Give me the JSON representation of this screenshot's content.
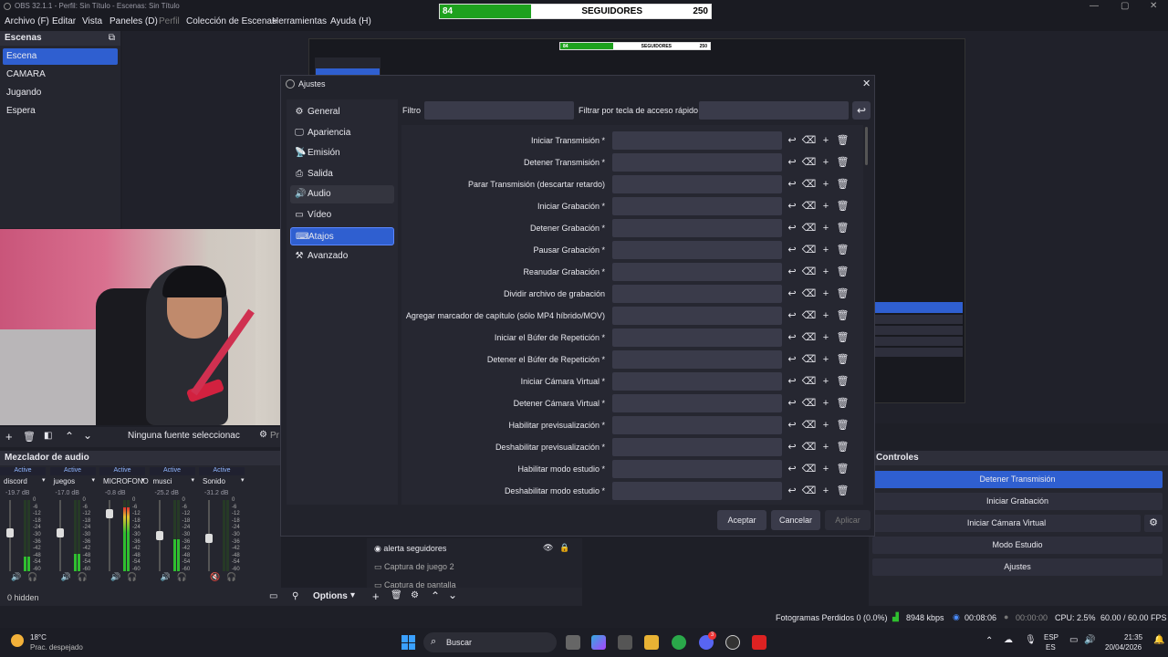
{
  "window": {
    "title": "OBS 32.1.1 - Perfil: Sin Título - Escenas: Sin Título"
  },
  "menu": [
    "Archivo (F)",
    "Editar",
    "Vista",
    "Paneles (D)",
    "Perfil",
    "Colección de Escenas",
    "Herramientas",
    "Ayuda (H)"
  ],
  "followers": {
    "current": "84",
    "label": "SEGUIDORES",
    "goal": "250",
    "progress": 0.336
  },
  "scenes": {
    "title": "Escenas",
    "items": [
      "Escena",
      "CAMARA",
      "Jugando",
      "Espera"
    ],
    "selected": 0
  },
  "sources_toolbar": {
    "no_source": "Ninguna fuente seleccionac",
    "props": "Pr"
  },
  "mixer": {
    "title": "Mezclador de audio",
    "channels": [
      {
        "name": "discord",
        "state": "Active",
        "db": "-19.7 dB",
        "level": 0.2,
        "fader": 0.55
      },
      {
        "name": "juegos",
        "state": "Active",
        "db": "-17.0 dB",
        "level": 0.25,
        "fader": 0.55
      },
      {
        "name": "MICROFONO",
        "state": "Active",
        "db": "-0.8 dB",
        "level": 0.9,
        "fader": 0.85
      },
      {
        "name": "musci",
        "state": "Active",
        "db": "-25.2 dB",
        "level": 0.45,
        "fader": 0.5
      },
      {
        "name": "Sonido",
        "state": "Active",
        "db": "-31.2 dB",
        "level": 0.0,
        "fader": 0.45
      }
    ],
    "scale": [
      "0",
      "-6",
      "-12",
      "-18",
      "-24",
      "-30",
      "-36",
      "-42",
      "-48",
      "-54",
      "-60"
    ],
    "hidden": "0 hidden",
    "options": "Options"
  },
  "sources": {
    "items": [
      "alerta seguidores",
      "Captura de juego 2",
      "Captura de pantalla"
    ]
  },
  "controls": {
    "title": "Controles",
    "buttons": [
      "Detener Transmisión",
      "Iniciar Grabación",
      "Iniciar Cámara Virtual",
      "Modo Estudio",
      "Ajustes"
    ]
  },
  "settings": {
    "title": "Ajustes",
    "nav": [
      "General",
      "Apariencia",
      "Emisión",
      "Salida",
      "Audio",
      "Vídeo",
      "Atajos",
      "Avanzado"
    ],
    "nav_selected": 6,
    "filter_label": "Filtro",
    "hotkey_filter_label": "Filtrar por tecla de acceso rápido",
    "hotkeys": [
      "Iniciar Transmisión *",
      "Detener Transmisión *",
      "Parar Transmisión (descartar retardo)",
      "Iniciar Grabación *",
      "Detener Grabación *",
      "Pausar Grabación *",
      "Reanudar Grabación *",
      "Dividir archivo de grabación",
      "Agregar marcador de capítulo (sólo MP4 híbrido/MOV)",
      "Iniciar el Búfer de Repetición *",
      "Detener el Búfer de Repetición *",
      "Iniciar Cámara Virtual *",
      "Detener Cámara Virtual *",
      "Habilitar previsualización *",
      "Deshabilitar previsualización *",
      "Habilitar modo estudio *",
      "Deshabilitar modo estudio *"
    ],
    "buttons": {
      "accept": "Aceptar",
      "cancel": "Cancelar",
      "apply": "Aplicar"
    }
  },
  "statusbar": {
    "dropped": "Fotogramas Perdidos 0 (0.0%)",
    "bitrate": "8948 kbps",
    "stream_time": "00:08:06",
    "rec_time": "00:00:00",
    "cpu": "CPU: 2.5%",
    "fps": "60.00 / 60.00 FPS"
  },
  "taskbar": {
    "weather_temp": "18°C",
    "weather_desc": "Prac. despejado",
    "search": "Buscar",
    "lang": "ESP",
    "lang2": "ES",
    "time": "21:35",
    "date": "20/04/2026",
    "discord_badge": "3"
  },
  "colors": {
    "accent": "#2f5fd0",
    "bg": "#1e1f27",
    "panel": "#25262f",
    "meter_green": "#2fbf2f"
  }
}
